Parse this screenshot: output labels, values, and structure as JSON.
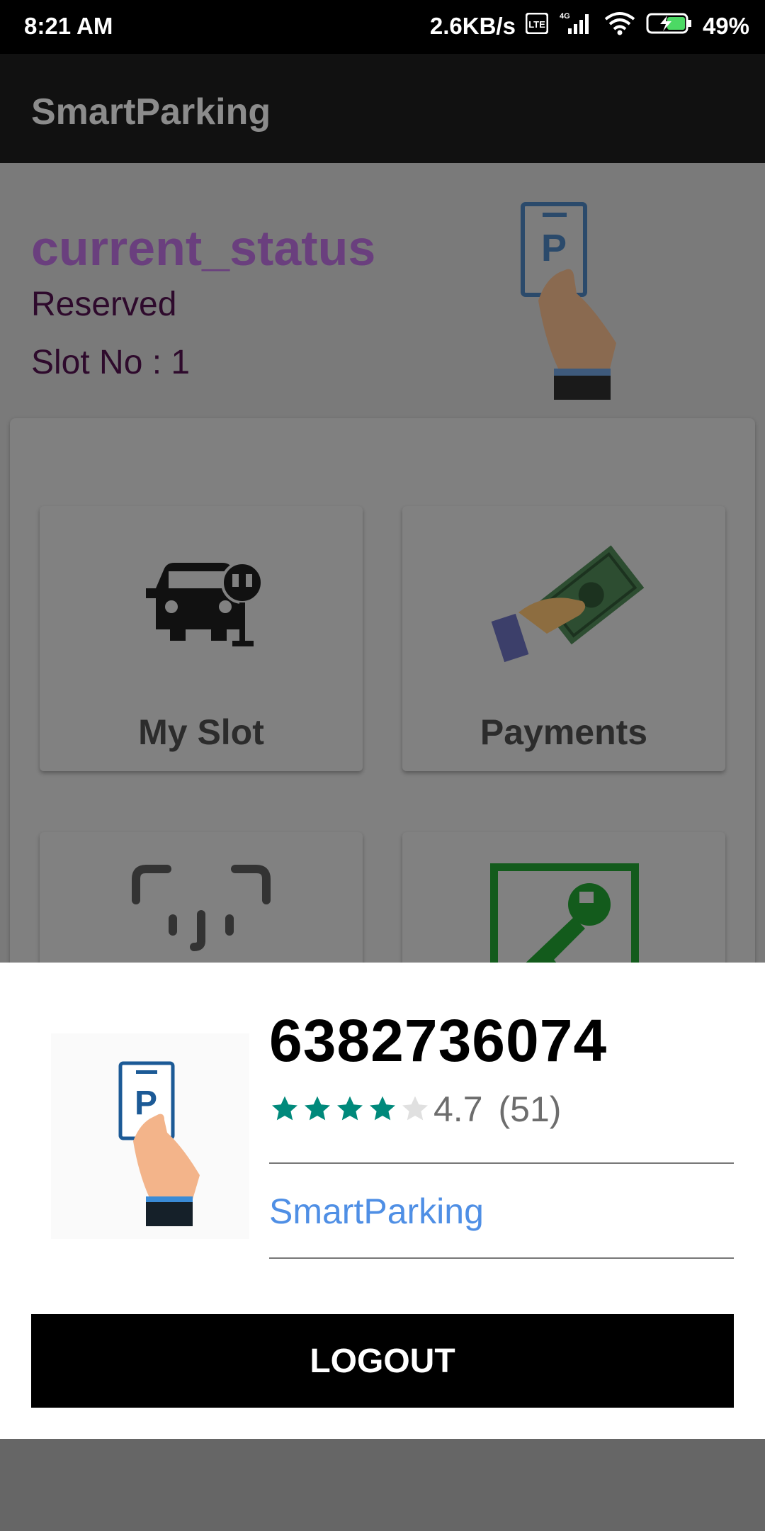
{
  "status_bar": {
    "time": "8:21 AM",
    "network_speed": "2.6KB/s",
    "battery": "49%"
  },
  "app_bar": {
    "title": "SmartParking"
  },
  "status": {
    "title": "current_status",
    "state": "Reserved",
    "slot": "Slot No : 1"
  },
  "tiles": [
    {
      "label": "My Slot",
      "icon": "car-parking-icon"
    },
    {
      "label": "Payments",
      "icon": "money-hand-icon"
    },
    {
      "icon": "face-id-icon"
    },
    {
      "icon": "key-icon"
    }
  ],
  "sheet": {
    "phone": "6382736074",
    "rating": "4.7",
    "rating_value": 4.7,
    "rating_count": "(51)",
    "app_name": "SmartParking",
    "logout_label": "LOGOUT"
  },
  "colors": {
    "accent": "#6a3f7e",
    "link": "#4f8fe5",
    "star": "#00897b"
  }
}
